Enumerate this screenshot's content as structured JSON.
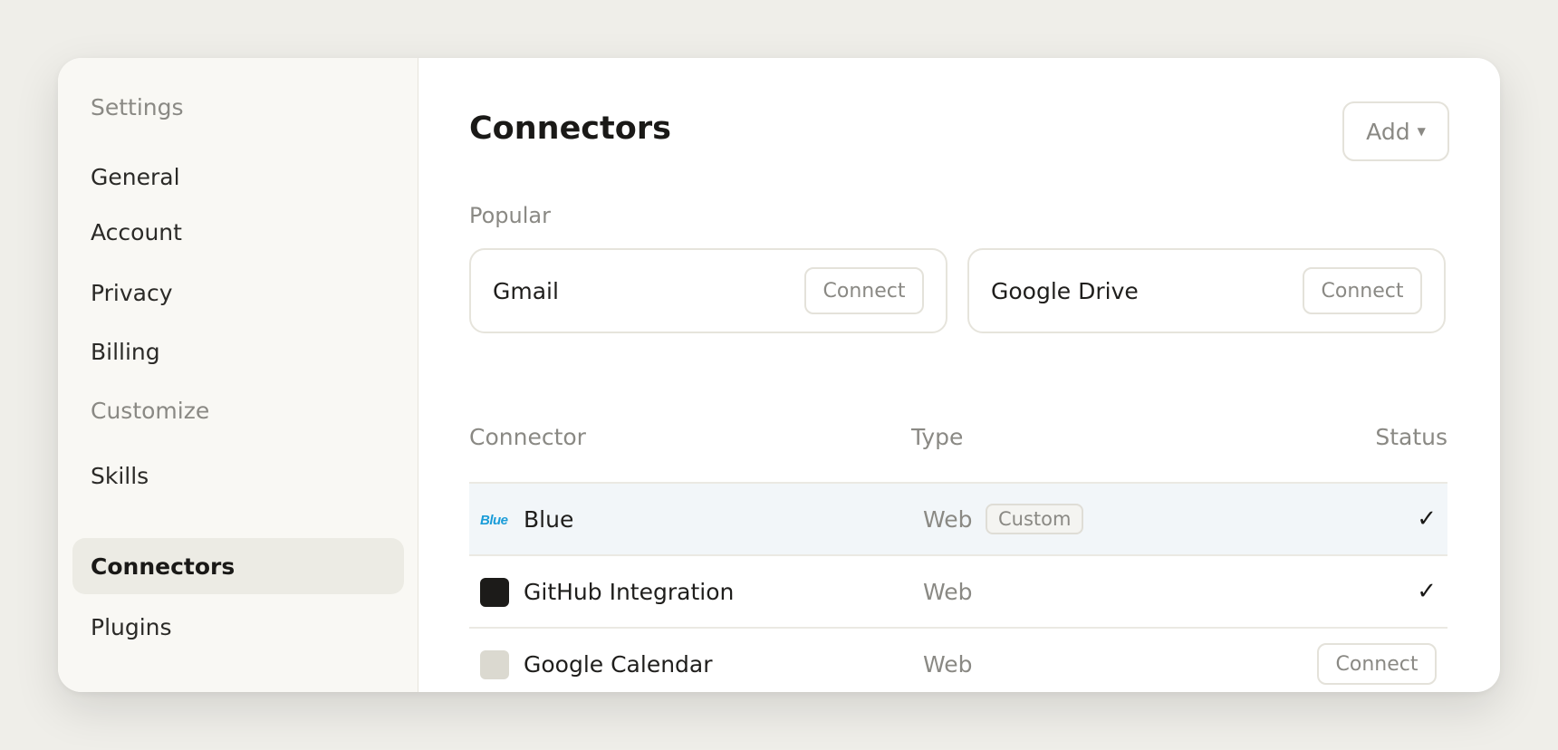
{
  "sidebar": {
    "settings_heading": "Settings",
    "items_top": [
      {
        "label": "General"
      },
      {
        "label": "Account"
      },
      {
        "label": "Privacy"
      },
      {
        "label": "Billing"
      }
    ],
    "customize_heading": "Customize",
    "items_bottom": [
      {
        "label": "Skills",
        "active": false
      },
      {
        "label": "Connectors",
        "active": true
      },
      {
        "label": "Plugins",
        "active": false
      }
    ]
  },
  "main": {
    "title": "Connectors",
    "add_button": {
      "label": "Add",
      "icon": "caret-down-icon"
    },
    "popular": {
      "label": "Popular",
      "cards": [
        {
          "name": "Gmail",
          "button": "Connect"
        },
        {
          "name": "Google Drive",
          "button": "Connect"
        }
      ]
    },
    "table": {
      "columns": [
        "Connector",
        "Type",
        "Status"
      ],
      "rows": [
        {
          "icon": "blue-logo-icon",
          "icon_text": "Blue",
          "name": "Blue",
          "type": "Web",
          "badge": "Custom",
          "status": "connected",
          "status_glyph": "✓",
          "highlighted": true
        },
        {
          "icon": "github-icon",
          "name": "GitHub Integration",
          "type": "Web",
          "status": "connected",
          "status_glyph": "✓",
          "highlighted": false
        },
        {
          "icon": "google-calendar-icon",
          "name": "Google Calendar",
          "type": "Web",
          "status": "not-connected",
          "status_button": "Connect",
          "highlighted": false
        }
      ]
    }
  },
  "colors": {
    "background": "#efeee9",
    "sidebar_bg": "#f9f8f4",
    "active_item_bg": "#ecebe4",
    "highlight_row_bg": "#f2f6f9",
    "blue_logo": "#1a9cd8",
    "muted_text": "#8a8984"
  }
}
